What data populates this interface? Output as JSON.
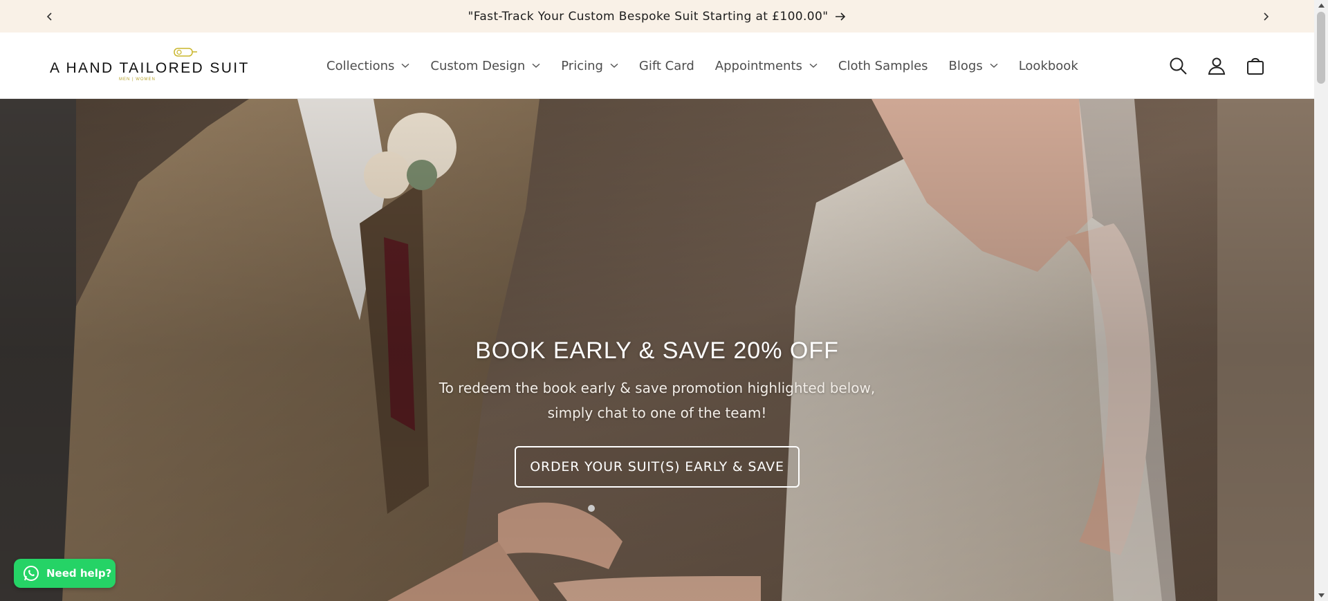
{
  "announcement": {
    "message": "\"Fast-Track Your Custom Bespoke Suit Starting at £100.00\"",
    "prev_icon": "chevron-left-icon",
    "next_icon": "chevron-right-icon"
  },
  "brand": {
    "logo_text": "A HAND TAILORED SUIT",
    "logo_sub": "MEN | WOMEN",
    "accent": "#c9b52a"
  },
  "nav": {
    "items": [
      {
        "label": "Collections",
        "dropdown": true
      },
      {
        "label": "Custom Design",
        "dropdown": true
      },
      {
        "label": "Pricing",
        "dropdown": true
      },
      {
        "label": "Gift Card",
        "dropdown": false
      },
      {
        "label": "Appointments",
        "dropdown": true
      },
      {
        "label": "Cloth Samples",
        "dropdown": false
      },
      {
        "label": "Blogs",
        "dropdown": true
      },
      {
        "label": "Lookbook",
        "dropdown": false
      }
    ]
  },
  "header_icons": [
    "search-icon",
    "account-icon",
    "cart-icon"
  ],
  "hero": {
    "title": "BOOK EARLY & SAVE 20% OFF",
    "text": "To redeem the book early & save promotion highlighted below, simply chat to one of the team!",
    "cta": "ORDER YOUR SUIT(S) EARLY & SAVE"
  },
  "whatsapp": {
    "label": "Need help?",
    "color": "#25d366"
  }
}
